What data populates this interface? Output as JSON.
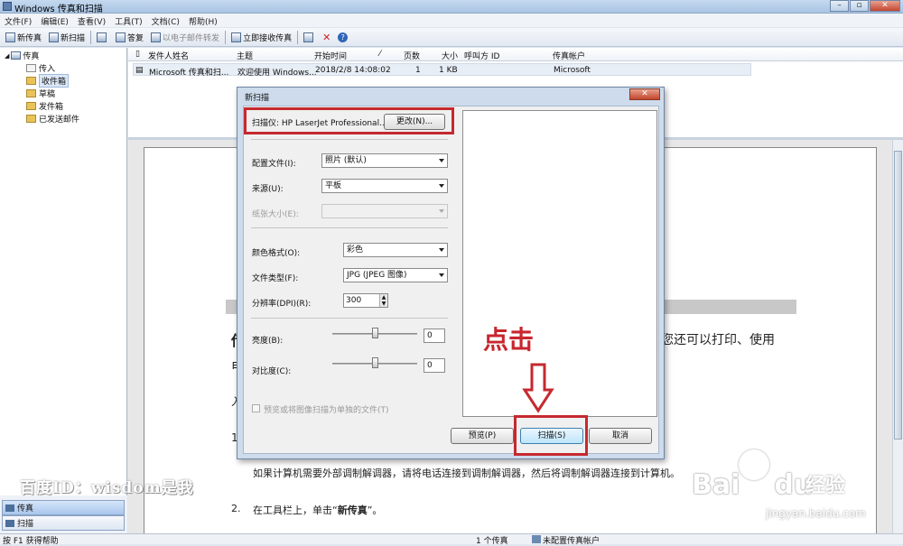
{
  "window": {
    "title": "Windows 传真和扫描"
  },
  "menu": [
    "文件(F)",
    "编辑(E)",
    "查看(V)",
    "工具(T)",
    "文档(C)",
    "帮助(H)"
  ],
  "toolbar": {
    "new_fax": "新传真",
    "new_scan": "新扫描",
    "reply": "答复",
    "forward_email": "以电子邮件转发",
    "receive_now": "立即接收传真"
  },
  "nav": {
    "root": "传真",
    "items": [
      "传入",
      "收件箱",
      "草稿",
      "发件箱",
      "已发送邮件"
    ],
    "bottom_buttons": [
      "传真",
      "扫描"
    ]
  },
  "list": {
    "columns": [
      "发件人姓名",
      "主题",
      "开始时间",
      "页数",
      "大小",
      "呼叫方 ID",
      "传真帐户"
    ],
    "rows": [
      {
        "sender": "Microsoft 传真和扫...",
        "subject": "欢迎使用 Windows...",
        "start": "2018/2/8 14:08:02",
        "pages": "1",
        "size": "1 KB",
        "caller_id": "",
        "account": "Microsoft"
      }
    ]
  },
  "document": {
    "heading_fragment_left": "传",
    "heading_fragment_right": "您还可以打印、使用",
    "line2_fragment": "电",
    "section_fragment": "入",
    "item1_number": "1.",
    "note": "如果计算机需要外部调制解调器，请将电话连接到调制解调器，然后将调制解调器连接到计算机。",
    "item2_number": "2.",
    "item2_text_prefix": "在工具栏上，单击“",
    "item2_text_bold": "新传真",
    "item2_text_suffix": "”。"
  },
  "status": {
    "help": "按 F1 获得帮助",
    "fax_count": "1 个传真",
    "account": "未配置传真帐户"
  },
  "dialog": {
    "title": "新扫描",
    "scanner_label": "扫描仪: HP LaserJet Professional...",
    "change_button": "更改(N)...",
    "profile_label": "配置文件(I):",
    "profile_value": "照片 (默认)",
    "source_label": "来源(U):",
    "source_value": "平板",
    "paper_size_label": "纸张大小(E):",
    "paper_size_value": "",
    "color_format_label": "颜色格式(O):",
    "color_format_value": "彩色",
    "file_type_label": "文件类型(F):",
    "file_type_value": "JPG (JPEG 图像)",
    "dpi_label": "分辨率(DPI)(R):",
    "dpi_value": "300",
    "brightness_label": "亮度(B):",
    "brightness_value": "0",
    "contrast_label": "对比度(C):",
    "contrast_value": "0",
    "separate_files_label": "预览或将图像扫描为单独的文件(T)",
    "preview_button": "预览(P)",
    "scan_button": "扫描(S)",
    "cancel_button": "取消"
  },
  "annotation": {
    "click_text": "点击"
  },
  "watermarks": {
    "author": "百度ID：wisdom是我",
    "baidu_logo": "Bai",
    "baidu_logo_tail": "du",
    "baidu_jingyan": "经验",
    "baidu_url": "jingyan.baidu.com"
  }
}
